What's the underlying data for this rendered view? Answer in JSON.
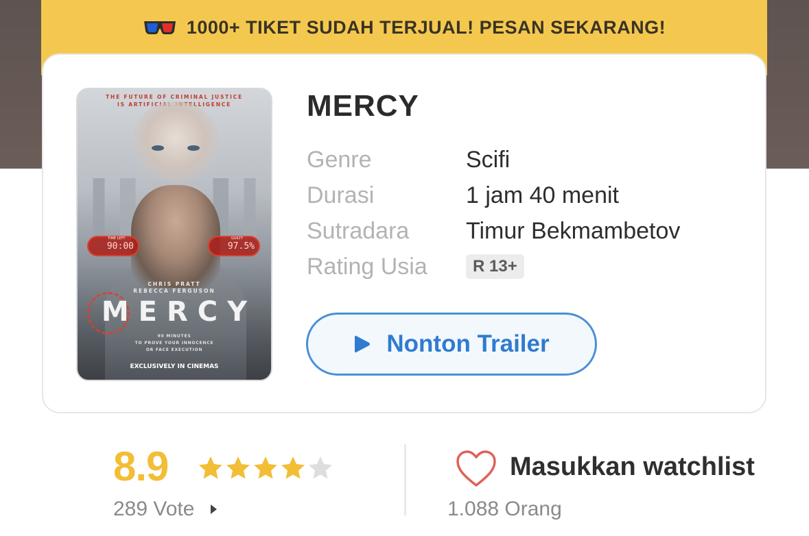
{
  "banner": {
    "icon": "3d-glasses-icon",
    "text": "1000+ TIKET SUDAH TERJUAL! PESAN SEKARANG!"
  },
  "movie": {
    "title": "MERCY",
    "poster": {
      "tagline_1": "THE FUTURE OF CRIMINAL JUSTICE",
      "tagline_2": "IS ARTIFICIAL INTELLIGENCE",
      "hud_left_label": "TIME LEFT",
      "hud_left_value": "90:00",
      "hud_right_label": "GUILTY",
      "hud_right_value": "97.5%",
      "credit_1": "CHRIS PRATT",
      "credit_2": "REBECCA FERGUSON",
      "title": "MERCY",
      "sub_1": "90 MINUTES",
      "sub_2": "TO PROVE YOUR INNOCENCE",
      "sub_3": "OR FACE EXECUTION",
      "exclusive": "EXCLUSIVELY IN CINEMAS"
    },
    "details": [
      {
        "label": "Genre",
        "value": "Scifi"
      },
      {
        "label": "Durasi",
        "value": "1 jam 40 menit"
      },
      {
        "label": "Sutradara",
        "value": "Timur Bekmambetov"
      },
      {
        "label": "Rating Usia",
        "value": "R 13+"
      }
    ],
    "trailer_label": "Nonton Trailer"
  },
  "rating": {
    "score": "8.9",
    "stars_filled": 4,
    "stars_total": 5,
    "votes": "289 Vote"
  },
  "watchlist": {
    "label": "Masukkan watchlist",
    "count": "1.088 Orang"
  },
  "colors": {
    "banner": "#f4c84f",
    "accent_blue": "#2f7bd0",
    "star_yellow": "#f2be36",
    "heart_red": "#e0605a"
  }
}
